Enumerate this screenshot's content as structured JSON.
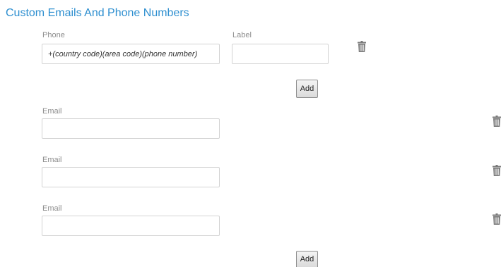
{
  "section": {
    "title": "Custom Emails And Phone Numbers"
  },
  "phone_row": {
    "phone_label": "Phone",
    "phone_placeholder": "+(country code)(area code)(phone number)",
    "phone_value": "",
    "label_label": "Label",
    "label_value": "",
    "delete_icon": "trash-icon"
  },
  "phone_add_button": "Add",
  "email_rows": [
    {
      "label": "Email",
      "value": "",
      "delete_icon": "trash-icon"
    },
    {
      "label": "Email",
      "value": "",
      "delete_icon": "trash-icon"
    },
    {
      "label": "Email",
      "value": "",
      "delete_icon": "trash-icon"
    }
  ],
  "email_add_button": "Add",
  "colors": {
    "title": "#2e8fd0",
    "label": "#8d8d8d",
    "input_border": "#d3d3d3",
    "icon": "#7a7a7a"
  }
}
